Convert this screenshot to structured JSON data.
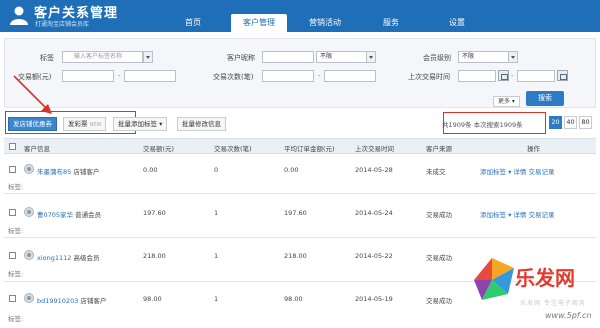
{
  "header": {
    "title": "客户关系管理",
    "subtitle": "打通淘宝店铺会员库",
    "nav": [
      "首页",
      "客户管理",
      "营销活动",
      "服务",
      "设置"
    ],
    "active_nav": "客户管理",
    "brand_color": "#1e6fb8"
  },
  "filters": {
    "tag_label": "标签",
    "tag_placeholder": "输入客户标签名称",
    "nickname_label": "客户昵称",
    "nickname_select": "不限",
    "level_label": "会员级别",
    "level_select": "不限",
    "amount_label": "交易额(元)",
    "amount_dash": "-",
    "count_label": "交易次数(笔)",
    "count_dash": "-",
    "last_time_label": "上次交易时间",
    "last_time_dash": "-",
    "more_label": "更多",
    "search_label": "搜索"
  },
  "toolbar": {
    "coupon_button": "发店铺优惠券",
    "lottery_button": "发彩票",
    "lottery_badge": "NEW",
    "batch_tag_button": "批量添加标签",
    "batch_edit_button": "批量修改信息",
    "stats_text": "共1909条 本次搜索1909条",
    "page_sizes": [
      "20",
      "40",
      "80"
    ],
    "page_size_selected": "20"
  },
  "table": {
    "headers": [
      "客户信息",
      "交易额(元)",
      "交易次数(笔)",
      "平均订单金额(元)",
      "上次交易时间",
      "客户来源",
      "操作"
    ],
    "rows": [
      {
        "name": "朱墨蒲布85",
        "level": "店铺客户",
        "amount": "0.00",
        "count": "0",
        "avg": "0.00",
        "last_time": "2014-05-28",
        "source": "未成交"
      },
      {
        "name": "曹0705家华",
        "level": "普通会员",
        "amount": "197.60",
        "count": "1",
        "avg": "197.60",
        "last_time": "2014-05-24",
        "source": "交易成功"
      },
      {
        "name": "xiong1112",
        "level": "高级会员",
        "amount": "218.00",
        "count": "1",
        "avg": "218.00",
        "last_time": "2014-05-22",
        "source": "交易成功"
      },
      {
        "name": "bd19910203",
        "level": "店铺客户",
        "amount": "98.00",
        "count": "1",
        "avg": "98.00",
        "last_time": "2014-05-19",
        "source": "交易成功"
      }
    ],
    "tag_prefix": "标签:",
    "actions": [
      "添加标签",
      "详情",
      "交易记录"
    ]
  },
  "watermark": {
    "text": "乐发网",
    "subtitle": "乐发网 专注电子商务",
    "url": "www.5pf.cn"
  }
}
